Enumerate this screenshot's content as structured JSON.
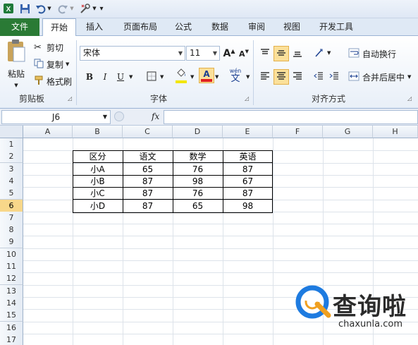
{
  "ribbon_tabs": [
    {
      "label": "文件"
    },
    {
      "label": "开始"
    },
    {
      "label": "插入"
    },
    {
      "label": "页面布局"
    },
    {
      "label": "公式"
    },
    {
      "label": "数据"
    },
    {
      "label": "审阅"
    },
    {
      "label": "视图"
    },
    {
      "label": "开发工具"
    }
  ],
  "clipboard": {
    "paste": "粘贴",
    "cut": "剪切",
    "copy": "复制",
    "format_painter": "格式刷",
    "group_label": "剪贴板"
  },
  "font": {
    "name": "宋体",
    "size": "11",
    "bold": "B",
    "italic": "I",
    "underline": "U",
    "font_color_letter": "A",
    "phonetic": "wén",
    "grow": "A",
    "shrink": "A",
    "group_label": "字体"
  },
  "alignment": {
    "wrap_text": "自动换行",
    "merge_center": "合并后居中",
    "group_label": "对齐方式"
  },
  "formula_bar": {
    "name_box": "J6",
    "fx": "fx",
    "formula": ""
  },
  "columns": [
    "A",
    "B",
    "C",
    "D",
    "E",
    "F",
    "G",
    "H"
  ],
  "rows": [
    "1",
    "2",
    "3",
    "4",
    "5",
    "6",
    "7",
    "8",
    "9",
    "10",
    "11",
    "12",
    "13",
    "14",
    "15",
    "16",
    "17"
  ],
  "table": {
    "header": [
      "区分",
      "语文",
      "数学",
      "英语"
    ],
    "rows": [
      [
        "小A",
        "65",
        "76",
        "87"
      ],
      [
        "小B",
        "87",
        "98",
        "67"
      ],
      [
        "小C",
        "87",
        "76",
        "87"
      ],
      [
        "小D",
        "87",
        "65",
        "98"
      ]
    ]
  },
  "watermark": {
    "title": "查询啦",
    "url": "chaxunla.com"
  },
  "colors": {
    "file_tab": "#2a7a35",
    "font_color_underline": "#e02020",
    "fill_highlight": "#f2e600",
    "selected_row_header": "#f8d78a",
    "watermark_accent": "#1e7be0"
  }
}
